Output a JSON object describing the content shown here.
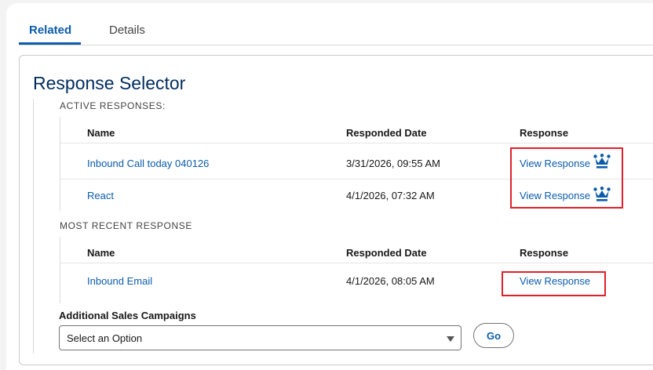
{
  "tabs": [
    {
      "label": "Related",
      "active": true
    },
    {
      "label": "Details",
      "active": false
    }
  ],
  "card": {
    "title": "Response Selector"
  },
  "active_responses": {
    "label": "ACTIVE RESPONSES:",
    "columns": [
      "Name",
      "Responded Date",
      "Response"
    ],
    "rows": [
      {
        "name": "Inbound Call today 040126",
        "date": "3/31/2026, 09:55 AM",
        "response": "View Response",
        "icon": "crown-icon"
      },
      {
        "name": "React",
        "date": "4/1/2026, 07:32 AM",
        "response": "View Response",
        "icon": "crown-icon"
      }
    ]
  },
  "recent_response": {
    "label": "MOST RECENT RESPONSE",
    "columns": [
      "Name",
      "Responded Date",
      "Response"
    ],
    "rows": [
      {
        "name": "Inbound Email",
        "date": "4/1/2026, 08:05 AM",
        "response": "View Response"
      }
    ]
  },
  "campaigns": {
    "label": "Additional Sales Campaigns",
    "placeholder": "Select an Option",
    "go_label": "Go"
  },
  "colors": {
    "brand": "#0b5cab",
    "title": "#032d60",
    "highlight": "#e0202a"
  }
}
